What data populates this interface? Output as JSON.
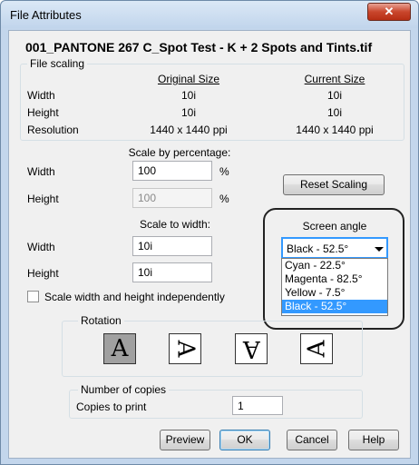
{
  "window": {
    "title": "File Attributes",
    "close_glyph": "✕"
  },
  "filename": "001_PANTONE 267 C_Spot Test - K + 2 Spots and Tints.tif",
  "file_scaling": {
    "legend": "File scaling",
    "original_header": "Original Size",
    "current_header": "Current Size",
    "rows": [
      {
        "label": "Width",
        "original": "10i",
        "current": "10i"
      },
      {
        "label": "Height",
        "original": "10i",
        "current": "10i"
      },
      {
        "label": "Resolution",
        "original": "1440 x 1440 ppi",
        "current": "1440 x 1440 ppi"
      }
    ]
  },
  "scale_percentage": {
    "heading": "Scale by percentage:",
    "width_label": "Width",
    "width_value": "100",
    "width_unit": "%",
    "height_label": "Height",
    "height_value": "100",
    "height_unit": "%"
  },
  "reset_scaling_label": "Reset Scaling",
  "scale_to_width": {
    "heading": "Scale to width:",
    "width_label": "Width",
    "width_value": "10i",
    "height_label": "Height",
    "height_value": "10i"
  },
  "scale_independently_label": "Scale width and height independently",
  "screen_angle": {
    "label": "Screen angle",
    "selected": "Black - 52.5°",
    "options": [
      "Cyan - 22.5°",
      "Magenta - 82.5°",
      "Yellow - 7.5°",
      "Black - 52.5°"
    ],
    "selected_index": 3
  },
  "rotation": {
    "legend": "Rotation",
    "glyphs": [
      "A",
      "A",
      "A",
      "A"
    ],
    "selected_index": 0
  },
  "copies": {
    "legend": "Number of copies",
    "label": "Copies to print",
    "value": "1"
  },
  "buttons": {
    "preview": "Preview",
    "ok": "OK",
    "cancel": "Cancel",
    "help": "Help"
  }
}
